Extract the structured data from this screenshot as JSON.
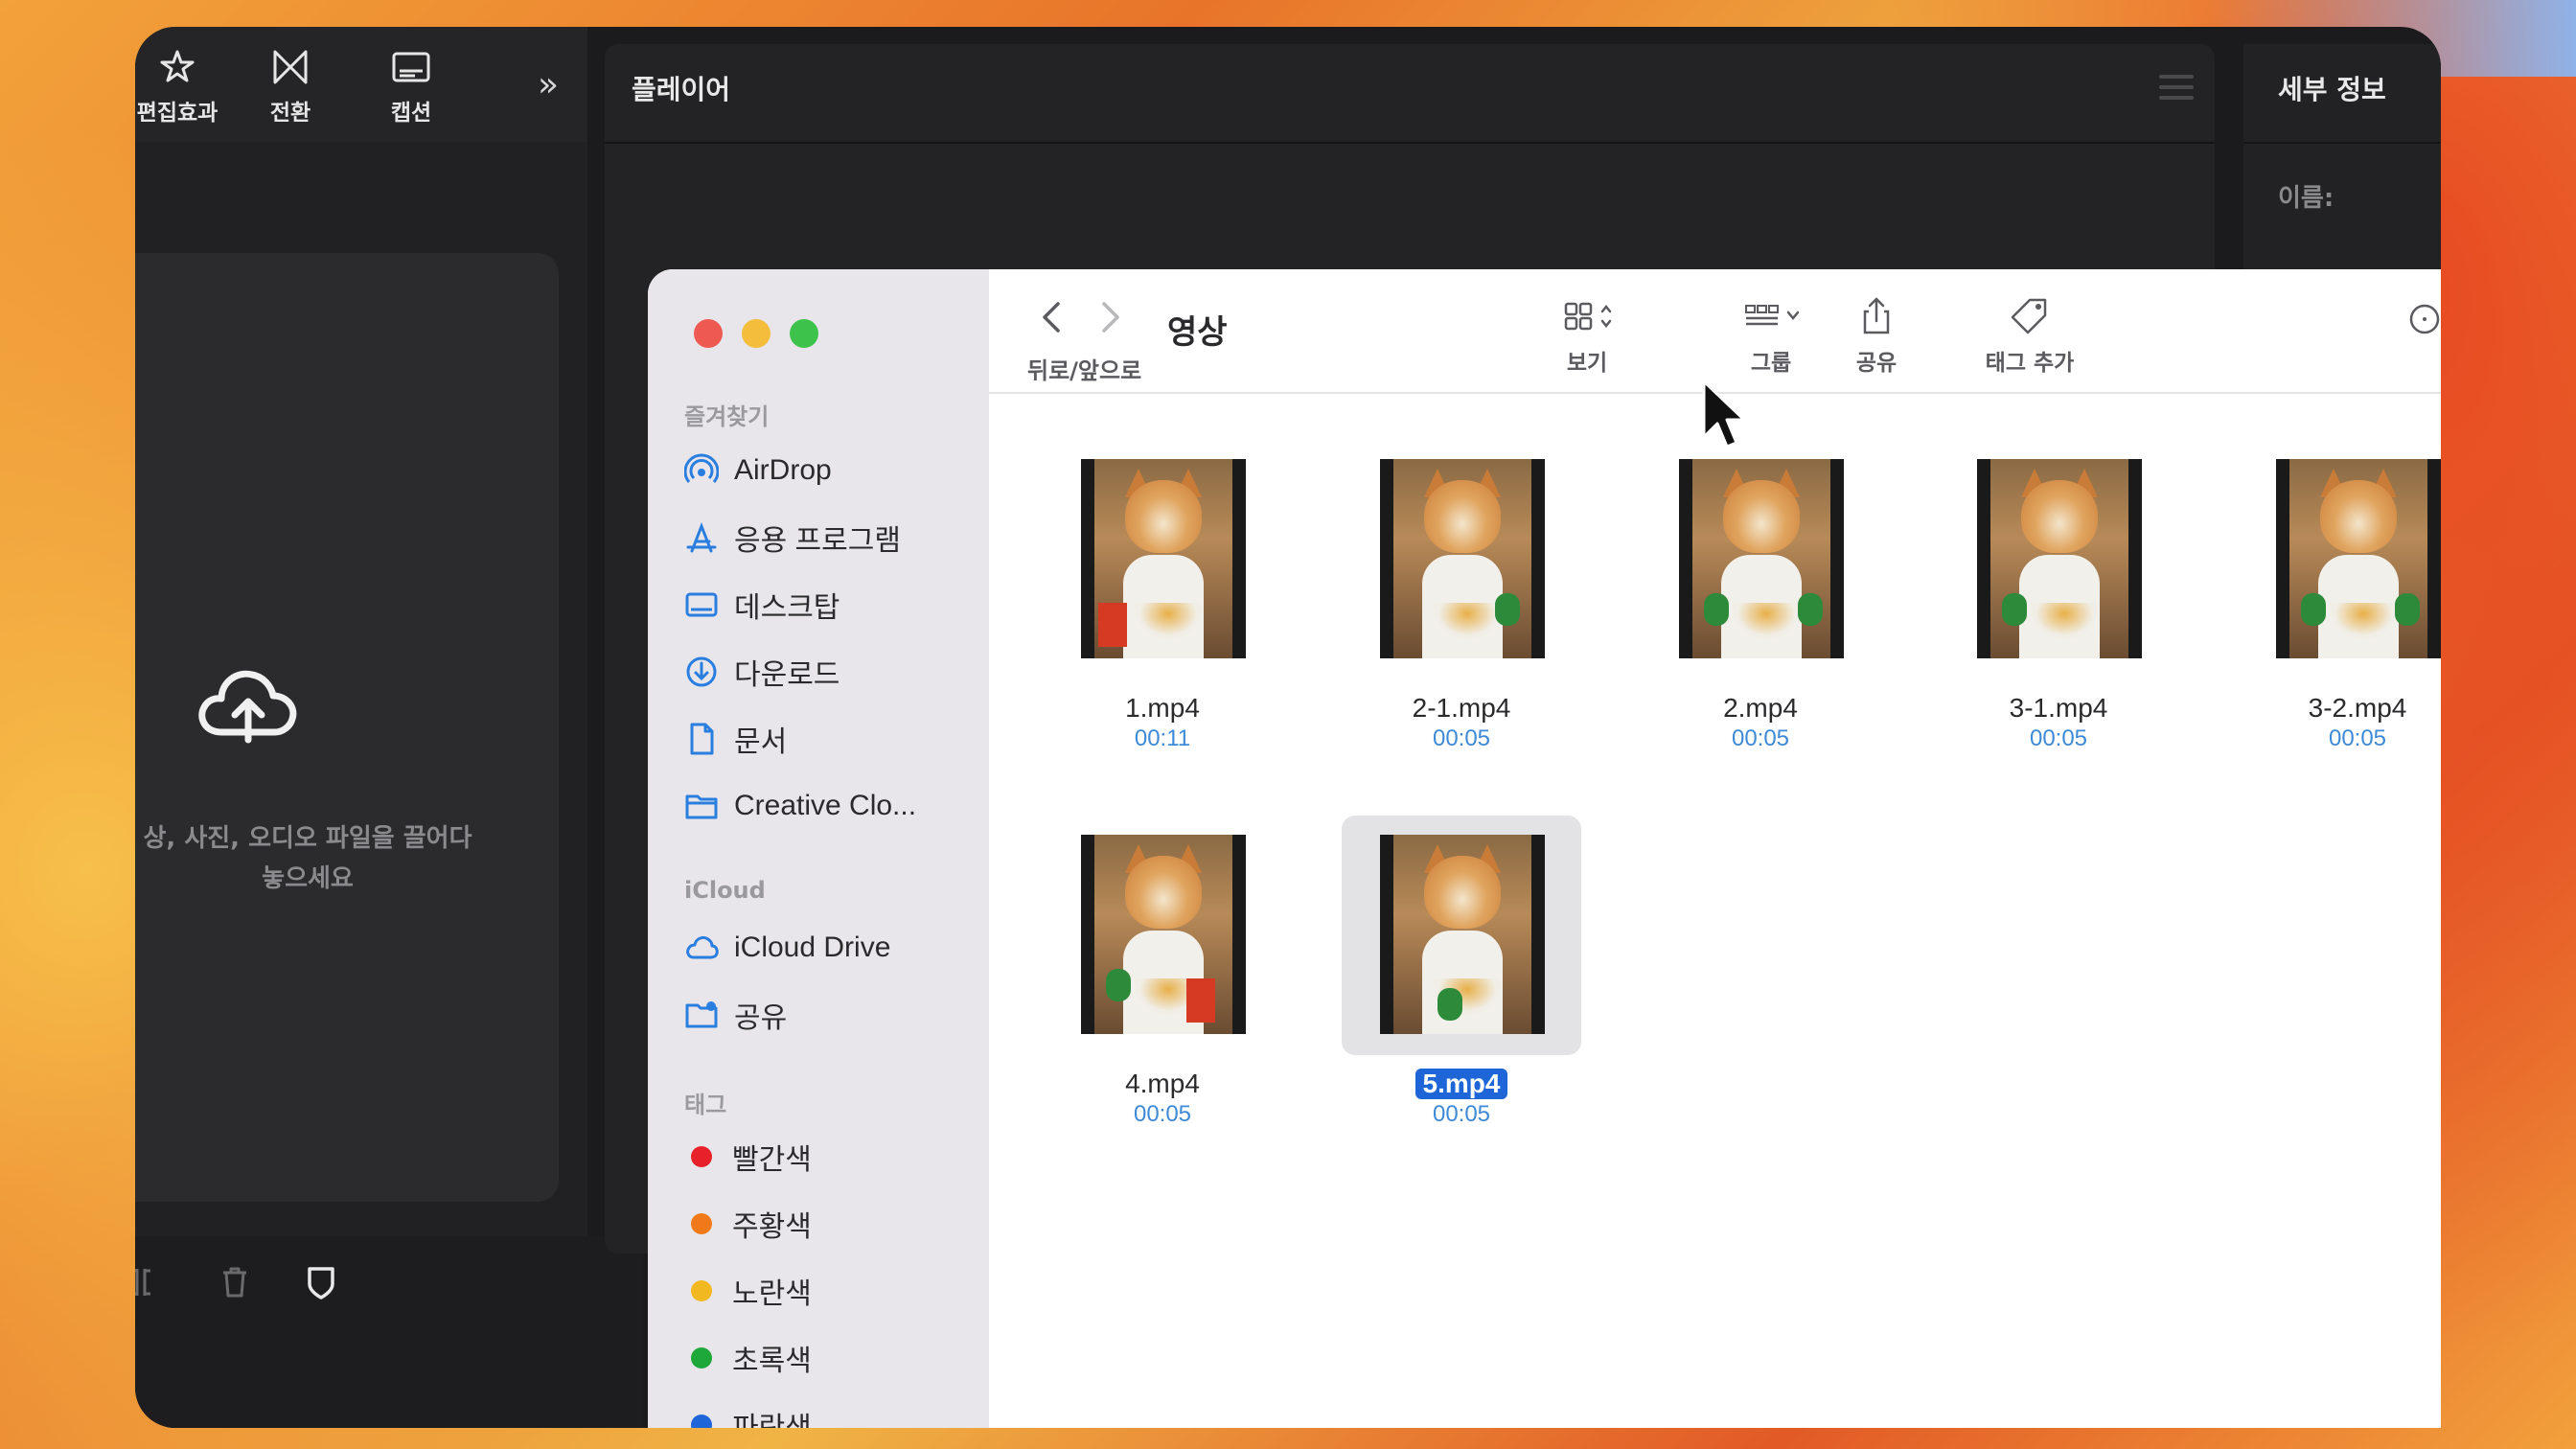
{
  "editor": {
    "tools": [
      {
        "label": "편집효과",
        "icon": "effects-icon"
      },
      {
        "label": "전환",
        "icon": "transition-icon"
      },
      {
        "label": "캡션",
        "icon": "caption-icon"
      }
    ],
    "more_icon": "double-chevron-right-icon",
    "drop_text_line1": "상, 사진, 오디오 파일을 끌어다",
    "drop_text_line2": "놓으세요",
    "player_title": "플레이어",
    "detail_title": "세부 정보",
    "detail_name_label": "이름:"
  },
  "finder": {
    "title": "영상",
    "nav_caption": "뒤로/앞으로",
    "toolbar": [
      {
        "label": "보기",
        "icon": "grid-view-icon"
      },
      {
        "label": "그룹",
        "icon": "group-icon"
      },
      {
        "label": "공유",
        "icon": "share-icon"
      },
      {
        "label": "태그 추가",
        "icon": "tag-icon"
      }
    ],
    "sidebar": {
      "favorites_header": "즐겨찾기",
      "favorites": [
        {
          "label": "AirDrop",
          "icon": "airdrop-icon"
        },
        {
          "label": "응용 프로그램",
          "icon": "applications-icon"
        },
        {
          "label": "데스크탑",
          "icon": "desktop-icon"
        },
        {
          "label": "다운로드",
          "icon": "downloads-icon"
        },
        {
          "label": "문서",
          "icon": "document-icon"
        },
        {
          "label": "Creative Clo...",
          "icon": "folder-icon"
        }
      ],
      "icloud_header": "iCloud",
      "icloud": [
        {
          "label": "iCloud Drive",
          "icon": "icloud-icon"
        },
        {
          "label": "공유",
          "icon": "shared-folder-icon"
        }
      ],
      "tags_header": "태그",
      "tags": [
        {
          "label": "빨간색",
          "color": "#e8202a"
        },
        {
          "label": "주황색",
          "color": "#f07a1a"
        },
        {
          "label": "노란색",
          "color": "#f2b820"
        },
        {
          "label": "초록색",
          "color": "#1fa83a"
        },
        {
          "label": "파란색",
          "color": "#1e66d8"
        }
      ]
    },
    "files": [
      {
        "name": "1.mp4",
        "duration": "00:11"
      },
      {
        "name": "2-1.mp4",
        "duration": "00:05"
      },
      {
        "name": "2.mp4",
        "duration": "00:05"
      },
      {
        "name": "3-1.mp4",
        "duration": "00:05"
      },
      {
        "name": "3-2.mp4",
        "duration": "00:05"
      },
      {
        "name": "4.mp4",
        "duration": "00:05"
      },
      {
        "name": "5.mp4",
        "duration": "00:05",
        "selected": true
      }
    ]
  },
  "colors": {
    "selection": "#1e66d8",
    "duration_text": "#3e8ad6",
    "close": "#ee5a52",
    "minimize": "#f4bd3b",
    "zoom": "#3dc34b"
  }
}
